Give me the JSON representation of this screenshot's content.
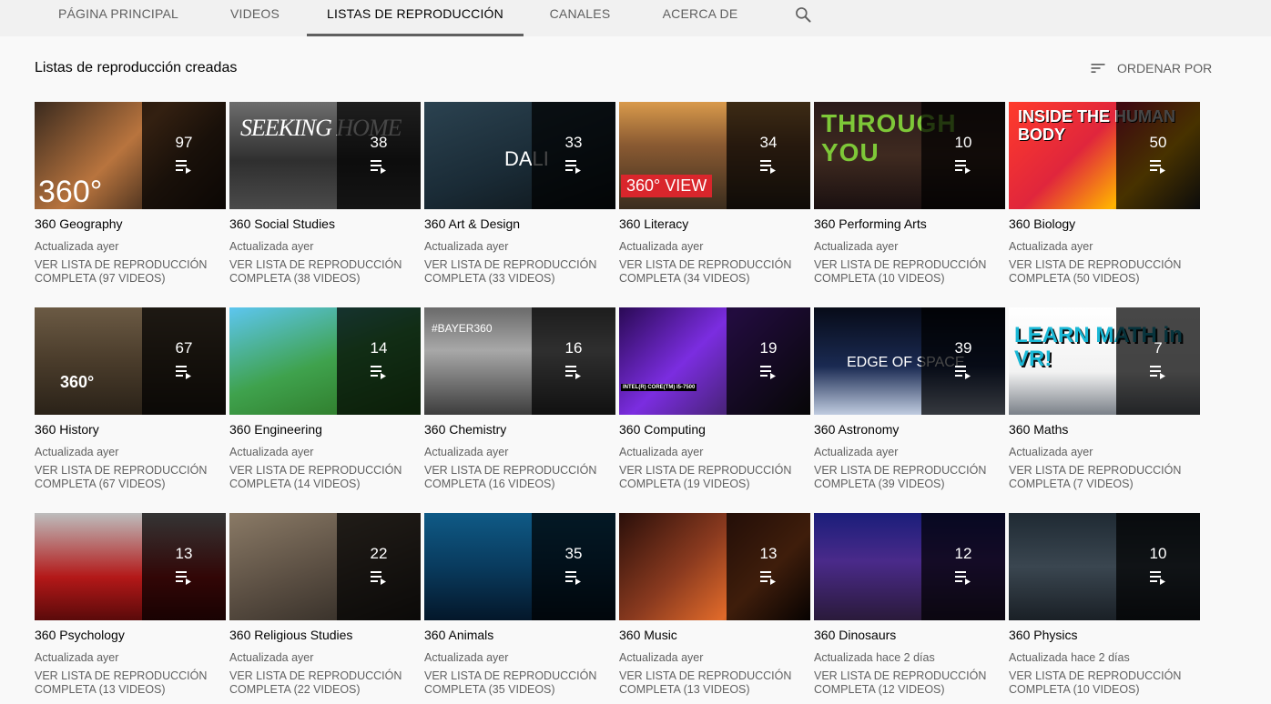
{
  "tabs": [
    {
      "label": "Página principal",
      "active": false
    },
    {
      "label": "Videos",
      "active": false
    },
    {
      "label": "Listas de reproducción",
      "active": true
    },
    {
      "label": "Canales",
      "active": false
    },
    {
      "label": "Acerca de",
      "active": false
    }
  ],
  "section": {
    "title": "Listas de reproducción creadas",
    "sort_label": "Ordenar por"
  },
  "colors": {
    "background": "#f9f9f9",
    "tabbar": "#f1f1f1",
    "text_primary": "#030303",
    "text_secondary": "#606060"
  },
  "playlists": [
    {
      "title": "360 Geography",
      "count": "97",
      "updated": "Actualizada ayer",
      "link": "Ver lista de reproducción completa (97 videos)",
      "thumb_text": "360°"
    },
    {
      "title": "360 Social Studies",
      "count": "38",
      "updated": "Actualizada ayer",
      "link": "Ver lista de reproducción completa (38 videos)",
      "thumb_text": "SEEKING HOME"
    },
    {
      "title": "360 Art & Design",
      "count": "33",
      "updated": "Actualizada ayer",
      "link": "Ver lista de reproducción completa (33 videos)",
      "thumb_text": "DALI"
    },
    {
      "title": "360 Literacy",
      "count": "34",
      "updated": "Actualizada ayer",
      "link": "Ver lista de reproducción completa (34 videos)",
      "thumb_text": "360° VIEW"
    },
    {
      "title": "360 Performing Arts",
      "count": "10",
      "updated": "Actualizada ayer",
      "link": "Ver lista de reproducción completa (10 videos)",
      "thumb_text": "THROUGH YOU"
    },
    {
      "title": "360 Biology",
      "count": "50",
      "updated": "Actualizada ayer",
      "link": "Ver lista de reproducción completa (50 videos)",
      "thumb_text": "INSIDE THE HUMAN BODY"
    },
    {
      "title": "360 History",
      "count": "67",
      "updated": "Actualizada ayer",
      "link": "Ver lista de reproducción completa (67 videos)",
      "thumb_text": "360°"
    },
    {
      "title": "360 Engineering",
      "count": "14",
      "updated": "Actualizada ayer",
      "link": "Ver lista de reproducción completa (14 videos)",
      "thumb_text": ""
    },
    {
      "title": "360 Chemistry",
      "count": "16",
      "updated": "Actualizada ayer",
      "link": "Ver lista de reproducción completa (16 videos)",
      "thumb_text": "#BAYER360"
    },
    {
      "title": "360 Computing",
      "count": "19",
      "updated": "Actualizada ayer",
      "link": "Ver lista de reproducción completa (19 videos)",
      "thumb_text": "INTEL(R) CORE(TM) I5-7500"
    },
    {
      "title": "360 Astronomy",
      "count": "39",
      "updated": "Actualizada ayer",
      "link": "Ver lista de reproducción completa (39 videos)",
      "thumb_text": "EDGE OF SPACE"
    },
    {
      "title": "360 Maths",
      "count": "7",
      "updated": "Actualizada ayer",
      "link": "Ver lista de reproducción completa (7 videos)",
      "thumb_text": "LEARN MATH in VR!"
    },
    {
      "title": "360 Psychology",
      "count": "13",
      "updated": "Actualizada ayer",
      "link": "Ver lista de reproducción completa (13 videos)",
      "thumb_text": ""
    },
    {
      "title": "360 Religious Studies",
      "count": "22",
      "updated": "Actualizada ayer",
      "link": "Ver lista de reproducción completa (22 videos)",
      "thumb_text": ""
    },
    {
      "title": "360 Animals",
      "count": "35",
      "updated": "Actualizada ayer",
      "link": "Ver lista de reproducción completa (35 videos)",
      "thumb_text": ""
    },
    {
      "title": "360 Music",
      "count": "13",
      "updated": "Actualizada ayer",
      "link": "Ver lista de reproducción completa (13 videos)",
      "thumb_text": ""
    },
    {
      "title": "360 Dinosaurs",
      "count": "12",
      "updated": "Actualizada hace 2 días",
      "link": "Ver lista de reproducción completa (12 videos)",
      "thumb_text": ""
    },
    {
      "title": "360 Physics",
      "count": "10",
      "updated": "Actualizada hace 2 días",
      "link": "Ver lista de reproducción completa (10 videos)",
      "thumb_text": ""
    }
  ]
}
